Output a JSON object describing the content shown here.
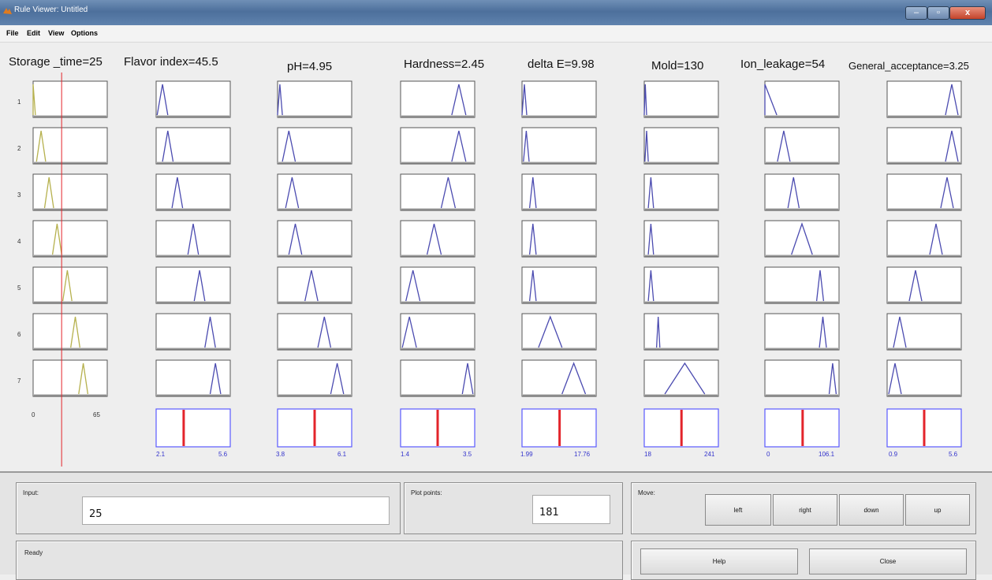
{
  "window": {
    "title": "Rule Viewer: Untitled",
    "controls": {
      "minimize": "–",
      "maximize": "▫",
      "close": "x"
    }
  },
  "menu": [
    "File",
    "Edit",
    "View",
    "Options"
  ],
  "colors": {
    "input_curve": "#b6b14e",
    "membership_curve": "#4b4bb0",
    "aggregate_border": "#5a5aff",
    "marker_line": "#e3242b",
    "tick_label": "#3333cc"
  },
  "rule_count": 7,
  "input_value_marker": 25,
  "row_labels": [
    "1",
    "2",
    "3",
    "4",
    "5",
    "6",
    "7"
  ],
  "variables": [
    {
      "name": "Storage _time",
      "title": "Storage _time=25",
      "kind": "input",
      "range": [
        0,
        65
      ],
      "range_labels": [
        "0",
        "65"
      ],
      "mf": [
        [
          0,
          0,
          2
        ],
        [
          3,
          7,
          11
        ],
        [
          10,
          14,
          18
        ],
        [
          17,
          21,
          25
        ],
        [
          26,
          30,
          34
        ],
        [
          33,
          37,
          41
        ],
        [
          40,
          44,
          48
        ]
      ]
    },
    {
      "name": "Flavor index",
      "title": "Flavor index=45.5",
      "kind": "output",
      "range": [
        2.1,
        5.6
      ],
      "range_labels": [
        "2.1",
        "5.6"
      ],
      "output_value": 3.4,
      "mf": [
        [
          2.15,
          2.4,
          2.65
        ],
        [
          2.4,
          2.65,
          2.9
        ],
        [
          2.85,
          3.1,
          3.35
        ],
        [
          3.6,
          3.85,
          4.1
        ],
        [
          3.9,
          4.15,
          4.4
        ],
        [
          4.4,
          4.65,
          4.9
        ],
        [
          4.65,
          4.9,
          5.15
        ]
      ]
    },
    {
      "name": "pH",
      "title": "pH=4.95",
      "kind": "output",
      "range": [
        3.8,
        6.1
      ],
      "range_labels": [
        "3.8",
        "6.1"
      ],
      "output_value": 4.95,
      "mf": [
        [
          3.8,
          3.87,
          3.95
        ],
        [
          3.95,
          4.15,
          4.35
        ],
        [
          4.05,
          4.25,
          4.45
        ],
        [
          4.15,
          4.35,
          4.55
        ],
        [
          4.65,
          4.85,
          5.05
        ],
        [
          5.05,
          5.25,
          5.45
        ],
        [
          5.45,
          5.65,
          5.85
        ]
      ]
    },
    {
      "name": "Hardness",
      "title": "Hardness=2.45",
      "kind": "output",
      "range": [
        1.4,
        3.5
      ],
      "range_labels": [
        "1.4",
        "3.5"
      ],
      "output_value": 2.45,
      "mf": [
        [
          2.85,
          3.05,
          3.25
        ],
        [
          2.85,
          3.05,
          3.25
        ],
        [
          2.55,
          2.75,
          2.95
        ],
        [
          2.15,
          2.35,
          2.55
        ],
        [
          1.55,
          1.75,
          1.95
        ],
        [
          1.45,
          1.65,
          1.85
        ],
        [
          3.15,
          3.3,
          3.45
        ]
      ]
    },
    {
      "name": "delta E",
      "title": "delta E=9.98",
      "kind": "output",
      "range": [
        1.99,
        17.76
      ],
      "range_labels": [
        "1.99",
        "17.76"
      ],
      "output_value": 9.98,
      "mf": [
        [
          1.99,
          2.5,
          3.0
        ],
        [
          2.3,
          2.9,
          3.5
        ],
        [
          3.6,
          4.3,
          5.0
        ],
        [
          3.6,
          4.3,
          5.0
        ],
        [
          3.6,
          4.3,
          5.0
        ],
        [
          5.5,
          8.0,
          10.5
        ],
        [
          10.5,
          13.0,
          15.5
        ]
      ]
    },
    {
      "name": "Mold",
      "title": "Mold=130",
      "kind": "output",
      "range": [
        18,
        241
      ],
      "range_labels": [
        "18",
        "241"
      ],
      "output_value": 130,
      "mf": [
        [
          18,
          21,
          25
        ],
        [
          20,
          25,
          30
        ],
        [
          30,
          38,
          46
        ],
        [
          30,
          38,
          46
        ],
        [
          30,
          38,
          46
        ],
        [
          55,
          60,
          65
        ],
        [
          80,
          140,
          200
        ]
      ]
    },
    {
      "name": "Ion_leakage",
      "title": "Ion_leakage=54",
      "kind": "output",
      "range": [
        0,
        106.1
      ],
      "range_labels": [
        "0",
        "106.1"
      ],
      "output_value": 54,
      "mf": [
        [
          0,
          0,
          17
        ],
        [
          18,
          27,
          36
        ],
        [
          33,
          41,
          49
        ],
        [
          38,
          53,
          68
        ],
        [
          74,
          79,
          84
        ],
        [
          78,
          83,
          88
        ],
        [
          92,
          97,
          102
        ]
      ]
    },
    {
      "name": "General_acceptance",
      "title": "General_acceptance=3.25",
      "kind": "output",
      "range": [
        0.9,
        5.6
      ],
      "range_labels": [
        "0.9",
        "5.6"
      ],
      "output_value": 3.25,
      "mf": [
        [
          4.6,
          5.0,
          5.4
        ],
        [
          4.6,
          5.0,
          5.4
        ],
        [
          4.3,
          4.7,
          5.1
        ],
        [
          3.6,
          4.0,
          4.4
        ],
        [
          2.3,
          2.7,
          3.1
        ],
        [
          1.3,
          1.7,
          2.1
        ],
        [
          1.0,
          1.4,
          1.8
        ]
      ]
    }
  ],
  "input_panel": {
    "label": "Input:",
    "value": "25"
  },
  "plot_points_panel": {
    "label": "Plot points:",
    "value": "181"
  },
  "move_panel": {
    "label": "Move:",
    "buttons": [
      "left",
      "right",
      "down",
      "up"
    ]
  },
  "status_panel": {
    "text": "Ready"
  },
  "action_buttons": {
    "help": "Help",
    "close": "Close"
  }
}
